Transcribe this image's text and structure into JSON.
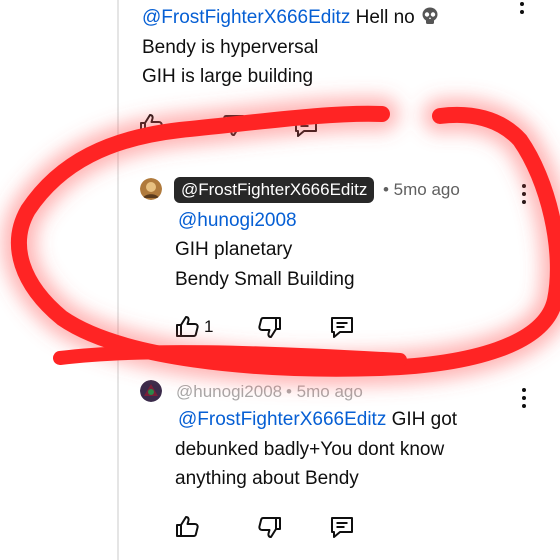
{
  "comment_1": {
    "mention": "@FrostFighterX666Editz",
    "text_first": "Hell no",
    "emoji_icon": "skull-emoji",
    "lines": [
      "Bendy is hyperversal",
      "GIH is large building"
    ]
  },
  "comment_2": {
    "author": "@FrostFighterX666Editz",
    "time": "• 5mo ago",
    "mention": "@hunogi2008",
    "lines": [
      "GIH planetary",
      "Bendy Small Building"
    ],
    "like_count": "1"
  },
  "comment_3": {
    "author": "@hunogi2008",
    "time": "• 5mo ago",
    "mention": "@FrostFighterX666Editz",
    "text_first": "GIH got",
    "lines": [
      "debunked badly+You dont know",
      "anything about Bendy"
    ]
  },
  "colors": {
    "mention": "#065fd4",
    "annotation_circle": "#ff2424",
    "author_highlight_bg": "#282828"
  }
}
